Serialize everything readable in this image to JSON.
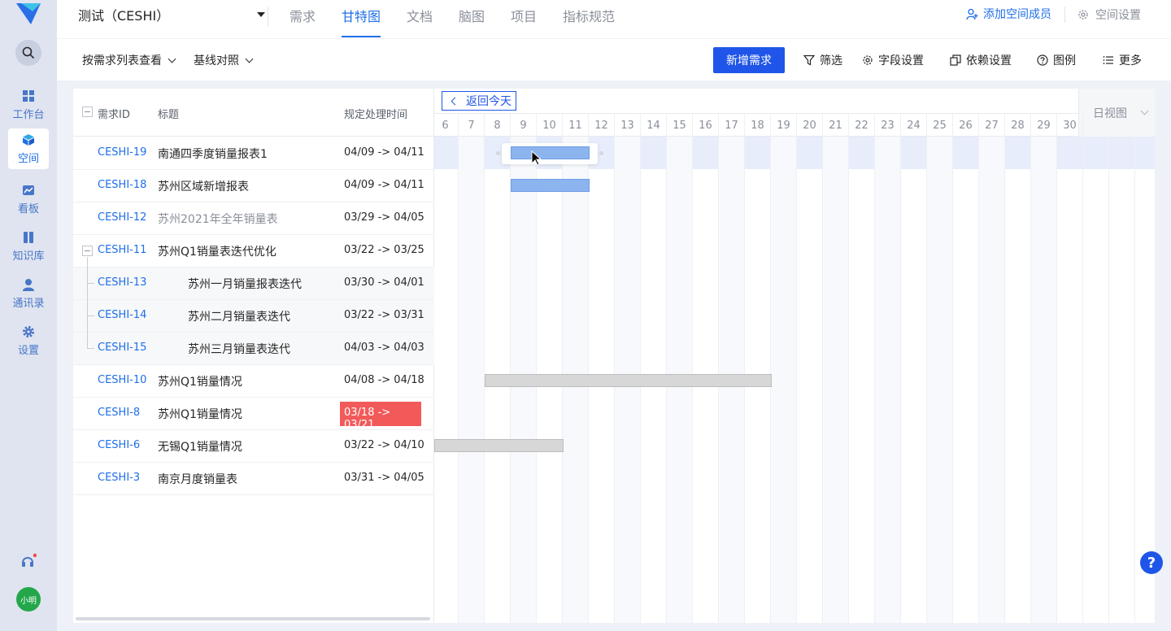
{
  "app": {
    "space_name": "测试（CESHI）"
  },
  "sidebar": {
    "avatar_text": "小明",
    "items": [
      {
        "label": "工作台",
        "icon": "dashboard-icon"
      },
      {
        "label": "空间",
        "icon": "cube-icon",
        "active": true
      },
      {
        "label": "看板",
        "icon": "chart-icon"
      },
      {
        "label": "知识库",
        "icon": "book-icon"
      },
      {
        "label": "通讯录",
        "icon": "contact-icon"
      },
      {
        "label": "设置",
        "icon": "gear-icon"
      }
    ]
  },
  "topbar": {
    "tabs": [
      "需求",
      "甘特图",
      "文档",
      "脑图",
      "项目",
      "指标规范"
    ],
    "active_tab": "甘特图",
    "add_member": "添加空间成员",
    "space_settings": "空间设置"
  },
  "toolbar": {
    "view_mode": "按需求列表查看",
    "baseline": "基线对照",
    "new_requirement": "新增需求",
    "filter": "筛选",
    "field_settings": "字段设置",
    "dependency_settings": "依赖设置",
    "legend": "图例",
    "more": "更多"
  },
  "list": {
    "headers": {
      "id": "需求ID",
      "title": "标题",
      "time": "规定处理时间"
    },
    "rows": [
      {
        "id": "CESHI-19",
        "title": "南通四季度销量报表1",
        "time": "04/09 -> 04/11"
      },
      {
        "id": "CESHI-18",
        "title": "苏州区域新增报表",
        "time": "04/09 -> 04/11"
      },
      {
        "id": "CESHI-12",
        "title": "苏州2021年全年销量表",
        "time": "03/29 -> 04/05"
      },
      {
        "id": "CESHI-11",
        "title": "苏州Q1销量表迭代优化",
        "time": "03/22 -> 03/25"
      },
      {
        "id": "CESHI-13",
        "title": "苏州一月销量报表迭代",
        "time": "03/30 -> 04/01"
      },
      {
        "id": "CESHI-14",
        "title": "苏州二月销量表迭代",
        "time": "03/22 -> 03/31"
      },
      {
        "id": "CESHI-15",
        "title": "苏州三月销量表迭代",
        "time": "04/03 -> 04/03"
      },
      {
        "id": "CESHI-10",
        "title": "苏州Q1销量情况",
        "time": "04/08 -> 04/18"
      },
      {
        "id": "CESHI-8",
        "title": "苏州Q1销量情况",
        "time": "03/18 -> 03/21"
      },
      {
        "id": "CESHI-6",
        "title": "无锡Q1销量情况",
        "time": "03/22 -> 04/10"
      },
      {
        "id": "CESHI-3",
        "title": "南京月度销量表",
        "time": "03/31 -> 04/05"
      }
    ]
  },
  "gantt": {
    "back_today": "返回今天",
    "view": "日视图",
    "days": [
      "6",
      "7",
      "8",
      "9",
      "10",
      "11",
      "12",
      "13",
      "14",
      "15",
      "16",
      "17",
      "18",
      "19",
      "20",
      "21",
      "22",
      "23",
      "24",
      "25",
      "26",
      "27",
      "28",
      "29",
      "30"
    ]
  },
  "help_float": "?",
  "colors": {
    "primary": "#1f55e8",
    "link": "#1f6fe8",
    "bar_blue": "#8cb4ef",
    "bar_gray": "#d7d7d7",
    "overdue": "#f25a5a"
  }
}
